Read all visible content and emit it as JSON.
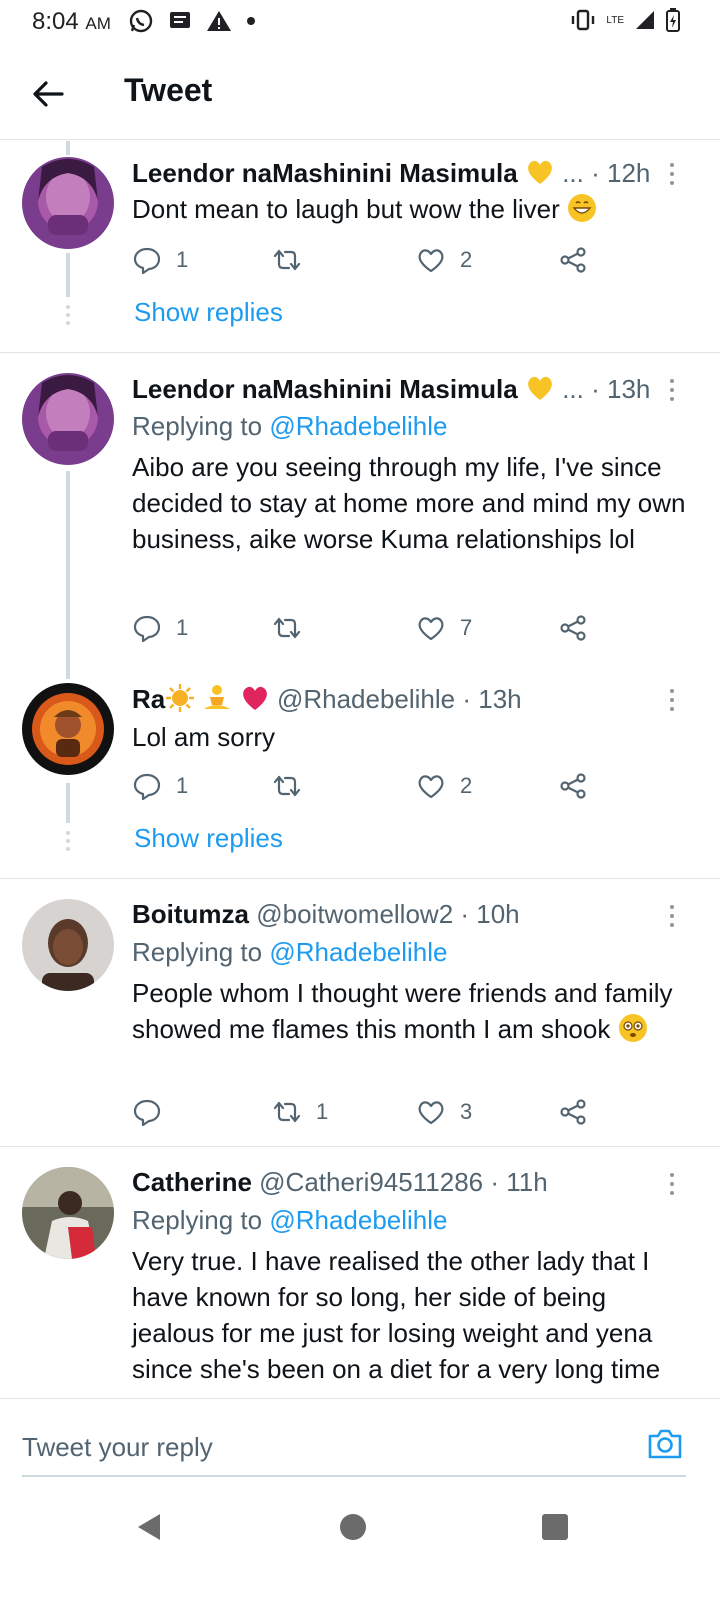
{
  "status_bar": {
    "time": "8:04",
    "ampm": "AM",
    "network": "LTE"
  },
  "header": {
    "title": "Tweet"
  },
  "tweets": [
    {
      "name": "Leendor naMashinini Masimula",
      "handle": "...",
      "time": "12h",
      "replying_label": "",
      "replying_handle": "",
      "text": "Dont mean to laugh but wow the liver",
      "replies": "1",
      "retweets": "",
      "likes": "2",
      "show_replies": "Show replies"
    },
    {
      "name": "Leendor naMashinini Masimula",
      "handle": "...",
      "time": "13h",
      "replying_label": "Replying to",
      "replying_handle": "@Rhadebelihle",
      "text": "Aibo are you seeing through my life, I've since decided to stay at home more and mind my own business, aike worse Kuma relationships lol",
      "replies": "1",
      "retweets": "",
      "likes": "7"
    },
    {
      "name": "Ra",
      "handle": "@Rhadebelihle",
      "time": "13h",
      "text": "Lol am sorry",
      "replies": "1",
      "retweets": "",
      "likes": "2",
      "show_replies": "Show replies"
    },
    {
      "name": "Boitumza",
      "handle": "@boitwomellow2",
      "time": "10h",
      "replying_label": "Replying to",
      "replying_handle": "@Rhadebelihle",
      "text": "People whom I thought were friends and family showed me flames this month I am shook",
      "replies": "",
      "retweets": "1",
      "likes": "3"
    },
    {
      "name": "Catherine",
      "handle": "@Catheri94511286",
      "time": "11h",
      "replying_label": "Replying to",
      "replying_handle": "@Rhadebelihle",
      "text": "Very true. I have realised the other lady that I have known for so long, her side of being jealous for me just for losing weight and yena since she's been on a diet for a very long time"
    }
  ],
  "reply_box": {
    "placeholder": "Tweet your reply"
  },
  "colors": {
    "link": "#1d9bf0",
    "secondary": "#536471",
    "emoji_yellow": "#f7c325",
    "heart_red": "#e0245e"
  },
  "icons": [
    "back-arrow-icon",
    "reply-icon",
    "retweet-icon",
    "like-icon",
    "share-icon",
    "more-icon",
    "camera-icon"
  ]
}
